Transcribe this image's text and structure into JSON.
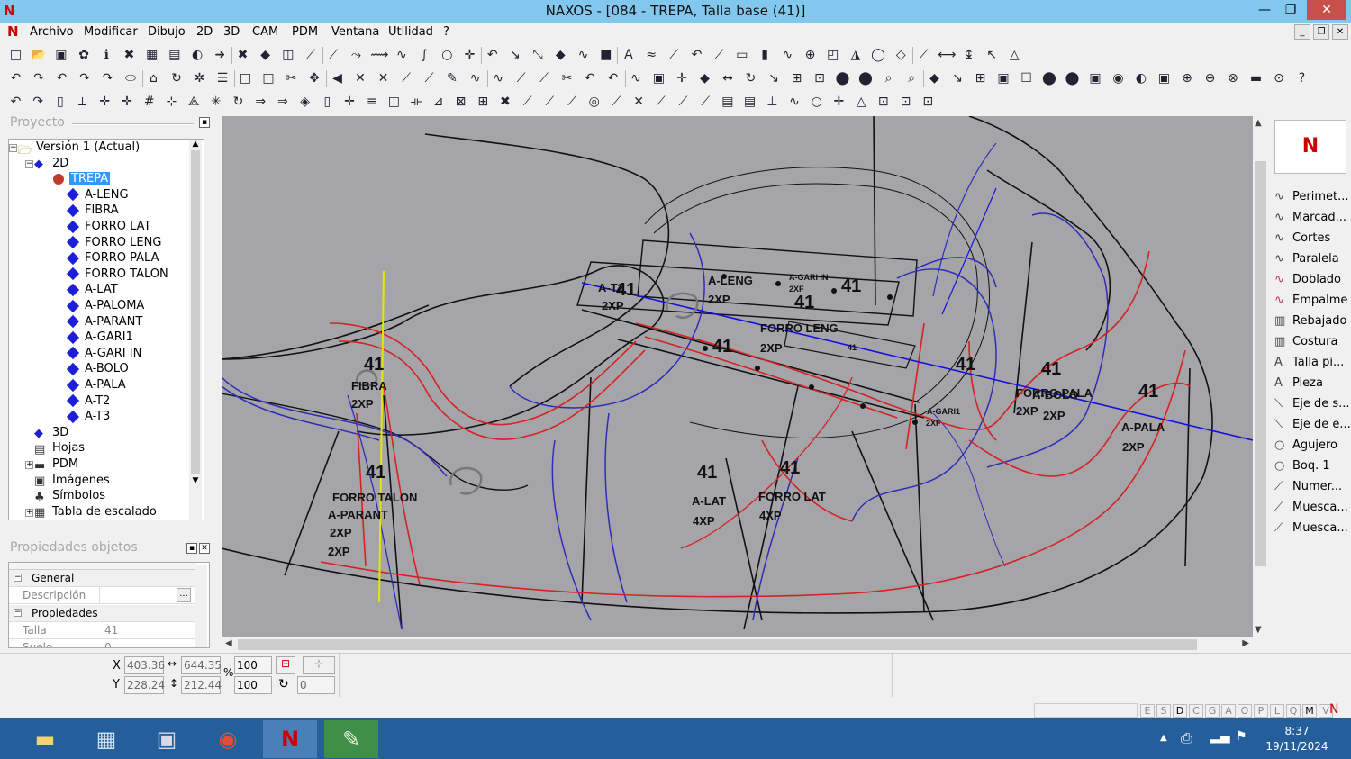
{
  "window": {
    "title": "NAXOS - [084 - TREPA, Talla base (41)]",
    "app_logo": "N",
    "close_glyph": "✕",
    "maximize_glyph": "❐",
    "minimize_glyph": "—"
  },
  "menu": [
    "Archivo",
    "Modificar",
    "Dibujo",
    "2D",
    "3D",
    "CAM",
    "PDM",
    "Ventana",
    "Utilidad",
    "?"
  ],
  "project_panel": {
    "title": "Proyecto",
    "tree": [
      {
        "label": "Versión 1 (Actual)",
        "type": "version"
      },
      {
        "label": "2D",
        "type": "folder"
      },
      {
        "label": "TREPA",
        "type": "piece",
        "selected": true
      },
      {
        "label": "A-LENG"
      },
      {
        "label": "FIBRA"
      },
      {
        "label": "FORRO LAT"
      },
      {
        "label": "FORRO LENG"
      },
      {
        "label": "FORRO PALA"
      },
      {
        "label": "FORRO TALON"
      },
      {
        "label": "A-LAT"
      },
      {
        "label": "A-PALOMA"
      },
      {
        "label": "A-PARANT"
      },
      {
        "label": "A-GARI1"
      },
      {
        "label": "A-GARI IN"
      },
      {
        "label": "A-BOLO"
      },
      {
        "label": "A-PALA"
      },
      {
        "label": "A-T2"
      },
      {
        "label": "A-T3"
      },
      {
        "label": "3D",
        "type": "folder3d"
      },
      {
        "label": "Hojas",
        "type": "sheets"
      },
      {
        "label": "PDM",
        "type": "pdm"
      },
      {
        "label": "Imágenes",
        "type": "images"
      },
      {
        "label": "Símbolos",
        "type": "symbols"
      },
      {
        "label": "Tabla de escalado",
        "type": "table"
      }
    ]
  },
  "props_panel": {
    "title": "Propiedades objetos",
    "section_general": "General",
    "label_desc": "Descripción",
    "desc_btn": "...",
    "section_props": "Propiedades",
    "label_talla": "Talla",
    "value_talla": "41",
    "label_suelo": "Suelo",
    "value_suelo": "0"
  },
  "right_tools": [
    "Perimet...",
    "Marcad...",
    "Cortes",
    "Paralela",
    "Doblado",
    "Empalme",
    "Rebajado",
    "Costura",
    "Talla pi...",
    "Pieza",
    "Eje de s...",
    "Eje de e...",
    "Agujero",
    "Boq. 1",
    "Numer...",
    "Muesca...",
    "Muesca..."
  ],
  "coords": {
    "x_label": "X",
    "y_label": "Y",
    "x": "403.36",
    "y": "228.24",
    "w": "644.35",
    "h": "212.44",
    "sx": "100",
    "sy": "100",
    "pct": "%",
    "rot": "0"
  },
  "status_letters": [
    "E",
    "S",
    "D",
    "C",
    "G",
    "A",
    "O",
    "P",
    "L",
    "Q",
    "M",
    "V"
  ],
  "clock": {
    "time": "8:37",
    "date": "19/11/2024"
  },
  "canvas_labels": {
    "big": [
      "41",
      "41",
      "41",
      "41",
      "41",
      "41",
      "41",
      "41",
      "41",
      "41",
      "41"
    ],
    "pieces": [
      "A-T2",
      "2XP",
      "A-LENG",
      "2XP",
      "A-GARI IN",
      "2XF",
      "FORRO LENG",
      "2XP",
      "41",
      "FIBRA",
      "2XP",
      "FORRO TALON",
      "A-PARANT",
      "2XP",
      "2XP",
      "A-LAT",
      "4XP",
      "FORRO LAT",
      "4XP",
      "FORRO PALA",
      "A-BOLO",
      "2XP",
      "2XP",
      "A-PALA",
      "2XP",
      "A-GARI1",
      "2XF"
    ]
  }
}
